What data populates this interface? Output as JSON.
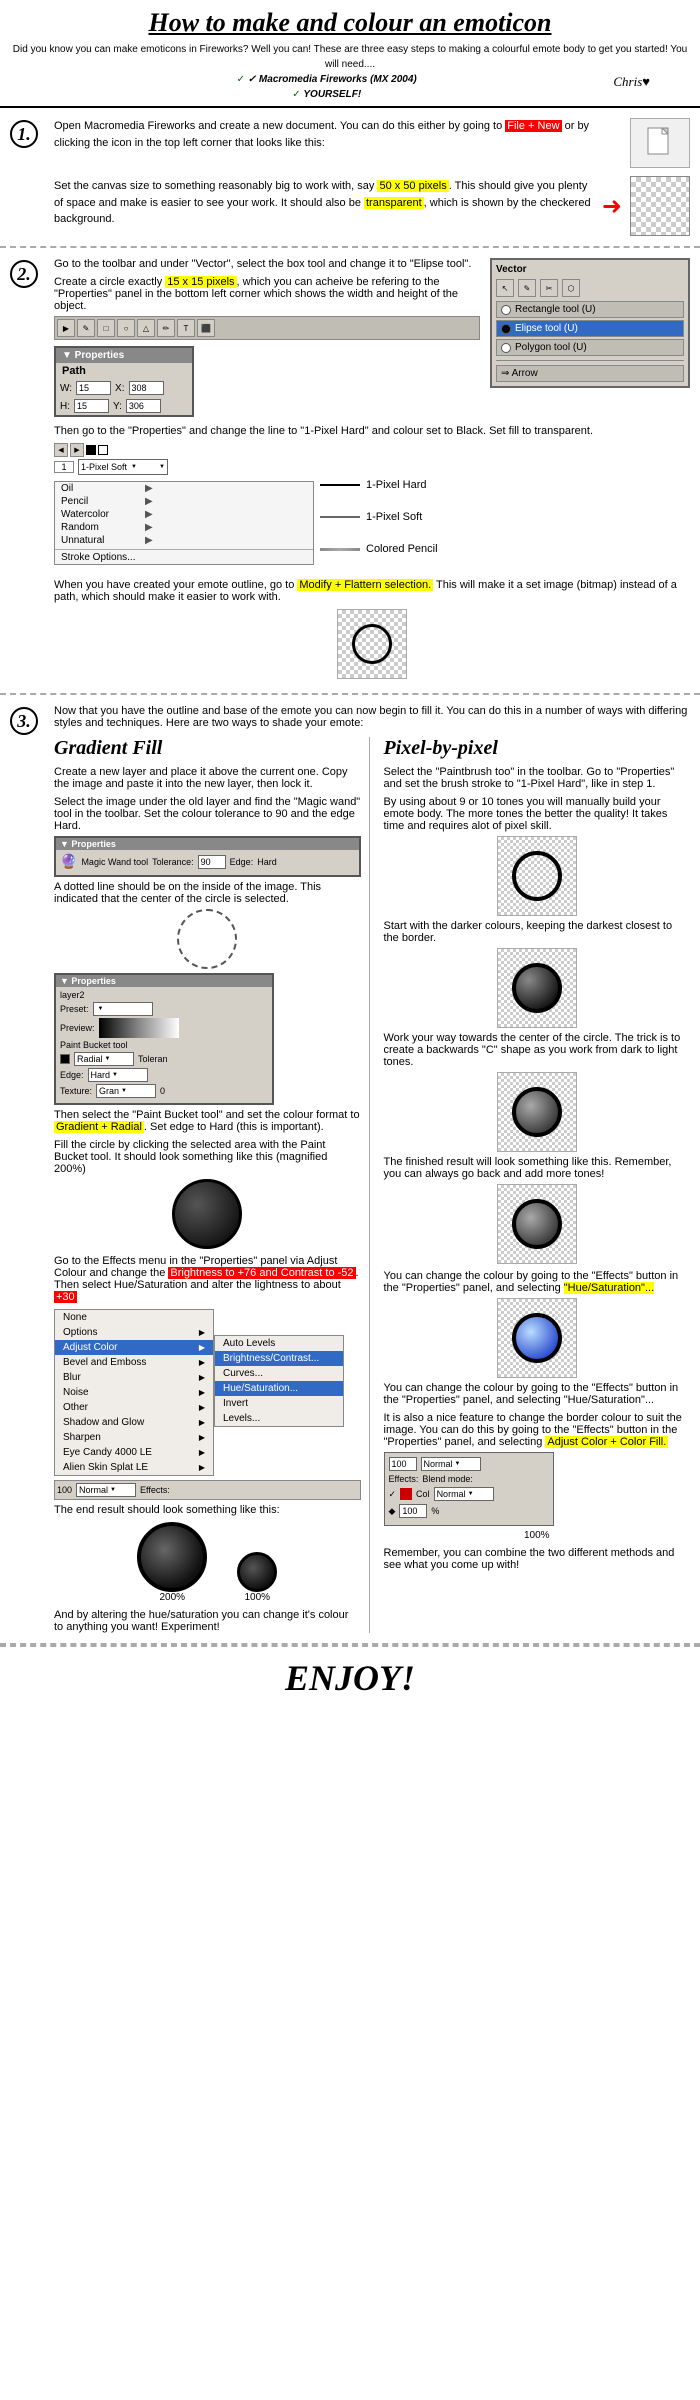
{
  "title": "How to make and colour an emoticon",
  "header": {
    "subtitle": "Did you know you can make emoticons in Fireworks? Well you can! These are three easy steps to making a colourful emote body to get you started! You will need....",
    "software": "✓ Macromedia Fireworks (MX 2004)",
    "self": "✓ YOURSELF!",
    "signature": "Chris♥"
  },
  "step1": {
    "number": "1.",
    "para1": "Open Macromedia Fireworks and create a new document. You can do this either by going to File + New or by clicking the icon in the top left corner that looks like this:",
    "para2": "Set the canvas size to something reasonably big to work with, say 50 x 50 pixels. This should give you plenty of space and make is easier to see your work. It should also be transparent, which is shown by the checkered background.",
    "highlight1": "File + New",
    "highlight2": "50 x 50 pixels",
    "highlight3": "transparent"
  },
  "step2": {
    "number": "2.",
    "para1": "Go to the toolbar and under \"Vector\", select the box tool and change it to \"Elipse tool\".",
    "para2": "Create a circle exactly 15 x 15 pixels, which you can acheive be refering to the \"Properties\" panel in the bottom left corner which shows the width and height of the object.",
    "highlight1": "15 x 15 pixels",
    "vector_panel_title": "Vector",
    "tools": [
      {
        "label": "Rectangle tool (U)",
        "active": false,
        "key": "U"
      },
      {
        "label": "Elipse tool (U)",
        "active": true,
        "key": "U"
      },
      {
        "label": "Polygon tool (U)",
        "active": false,
        "key": "U"
      },
      {
        "label": "→ Arrow",
        "active": false
      }
    ],
    "properties_label": "▼ Properties",
    "path_label": "Path",
    "w_label": "W:",
    "w_val": "15",
    "x_label": "X:",
    "x_val": "308",
    "h_label": "H:",
    "h_val": "15",
    "y_label": "Y:",
    "y_val": "306",
    "para3": "Then go to the \"Properties\" and change the line to \"1-Pixel Hard\" and colour set to Black. Set fill to transparent.",
    "stroke_options": [
      {
        "label": "Oil",
        "has_arrow": true
      },
      {
        "label": "Pencil",
        "has_arrow": true
      },
      {
        "label": "Watercolor",
        "has_arrow": true
      },
      {
        "label": "Random",
        "has_arrow": true
      },
      {
        "label": "Unnatural",
        "has_arrow": true
      },
      {
        "label": "Stroke Options...",
        "has_arrow": false
      }
    ],
    "stroke_types": [
      "1-Pixel Hard",
      "1-Pixel Soft",
      "Colored Pencil"
    ],
    "stroke_current": "1-Pixel Soft",
    "para4": "When you have created your emote outline, go to Modify + Flattern selection. This will make it a set image (bitmap) instead of a path, which should make it easier to work with.",
    "highlight4": "Modify + Flattern selection."
  },
  "step3": {
    "number": "3.",
    "intro": "Now that you have the outline and base of the emote you can now begin to fill it. You can do this in a number of ways with differing styles and techniques. Here are two ways to shade your emote:",
    "gradient_title": "Gradient Fill",
    "pixelbypixel_title": "Pixel-by-pixel",
    "gradient_steps": [
      "Create a new layer and place it above the current one. Copy the image and paste it into the new layer, then lock it.",
      "Select the image under the old layer and find the \"Magic wand\" tool in the toolbar. Set the colour tolerance to 90 and the edge Hard.",
      "A dotted line should be on the inside of the image. This indicated that the center of the circle is selected.",
      "Then select the \"Paint Bucket tool\" and set the colour format to Gradient + Radial. Set edge to Hard (this is important).",
      "Fill the circle by clicking the selected area with the Paint Bucket tool. It should look something like this (magnified 200%)",
      "Go to the Effects menu in the \"Properties\" panel via Adjust Colour and change the Brightness to +76 and Contrast to -52. Then select Hue/Saturation and alter the lightness to about +30"
    ],
    "gradient_highlights": [
      "Gradient + Radial",
      "Brightness to +76 and Contrast to -52",
      "+30"
    ],
    "pixel_steps": [
      "Select the \"Paintbrush too\" in the toolbar. Go to \"Properties\" and set the brush stroke to \"1-Pixel Hard\", like in step 1.",
      "By using about 9 or 10 tones you will manually build your emote body. The more tones the better the quality! It takes time and requires alot of pixel skill.",
      "Start with the darker colours, keeping the darkest closest to the border.",
      "Work your way towards the center of the circle. The trick is to create a backwards \"C\" shape as you work from dark to light tones.",
      "The finished result will look something like this. Remember, you can always go back and add more tones!"
    ],
    "colour_change": "You can change the colour by going to the \"Effects\" button in the \"Properties\" panel, and selecting \"Hue/Saturation\"...",
    "colour_change2": "You can change the colour by going to the \"Effects\" button in the \"Properties\" panel, and selecting \"Hue/Saturation\"...",
    "colour_highlight": "Hue/Saturation\"...",
    "border_change": "It is also a nice feature to change the border colour to suit the image. You can do this by going to the \"Effects\" button in the \"Properties\" panel, and selecting Adjust Color + Color Fill.",
    "border_highlight": "Adjust Color + Color Fill.",
    "effects_menu_items": [
      {
        "label": "None",
        "has_arrow": false
      },
      {
        "label": "Options",
        "has_arrow": true
      },
      {
        "label": "Adjust Color",
        "has_arrow": true
      },
      {
        "label": "Bevel and Emboss",
        "has_arrow": true
      },
      {
        "label": "Blur",
        "has_arrow": true
      },
      {
        "label": "Noise",
        "has_arrow": true
      },
      {
        "label": "Other",
        "has_arrow": true
      },
      {
        "label": "Shadow and Glow",
        "has_arrow": true
      },
      {
        "label": "Sharpen",
        "has_arrow": true
      },
      {
        "label": "Eye Candy 4000 LE",
        "has_arrow": true
      },
      {
        "label": "Alien Skin Splat LE",
        "has_arrow": true
      }
    ],
    "submenu_items": [
      "Auto Levels",
      "Brightness/Contrast...",
      "Curves...",
      "Hue/Saturation...",
      "Invert",
      "Levels..."
    ],
    "wand_tolerance": "90",
    "wand_edge": "Hard",
    "blend_mode": "Normal",
    "blend_mode2": "Normal",
    "opacity": "100",
    "effects_label": "Effects:",
    "end_text": "The end result should look something like this:",
    "magnified_200": "200%",
    "magnified_100": "100%",
    "final_text": "And by altering the hue/saturation you can change it's colour to anything you want! Experiment!",
    "remember_text": "Remember, you can combine the two different methods and see what you come up with!"
  },
  "enjoy": "ENJOY!"
}
